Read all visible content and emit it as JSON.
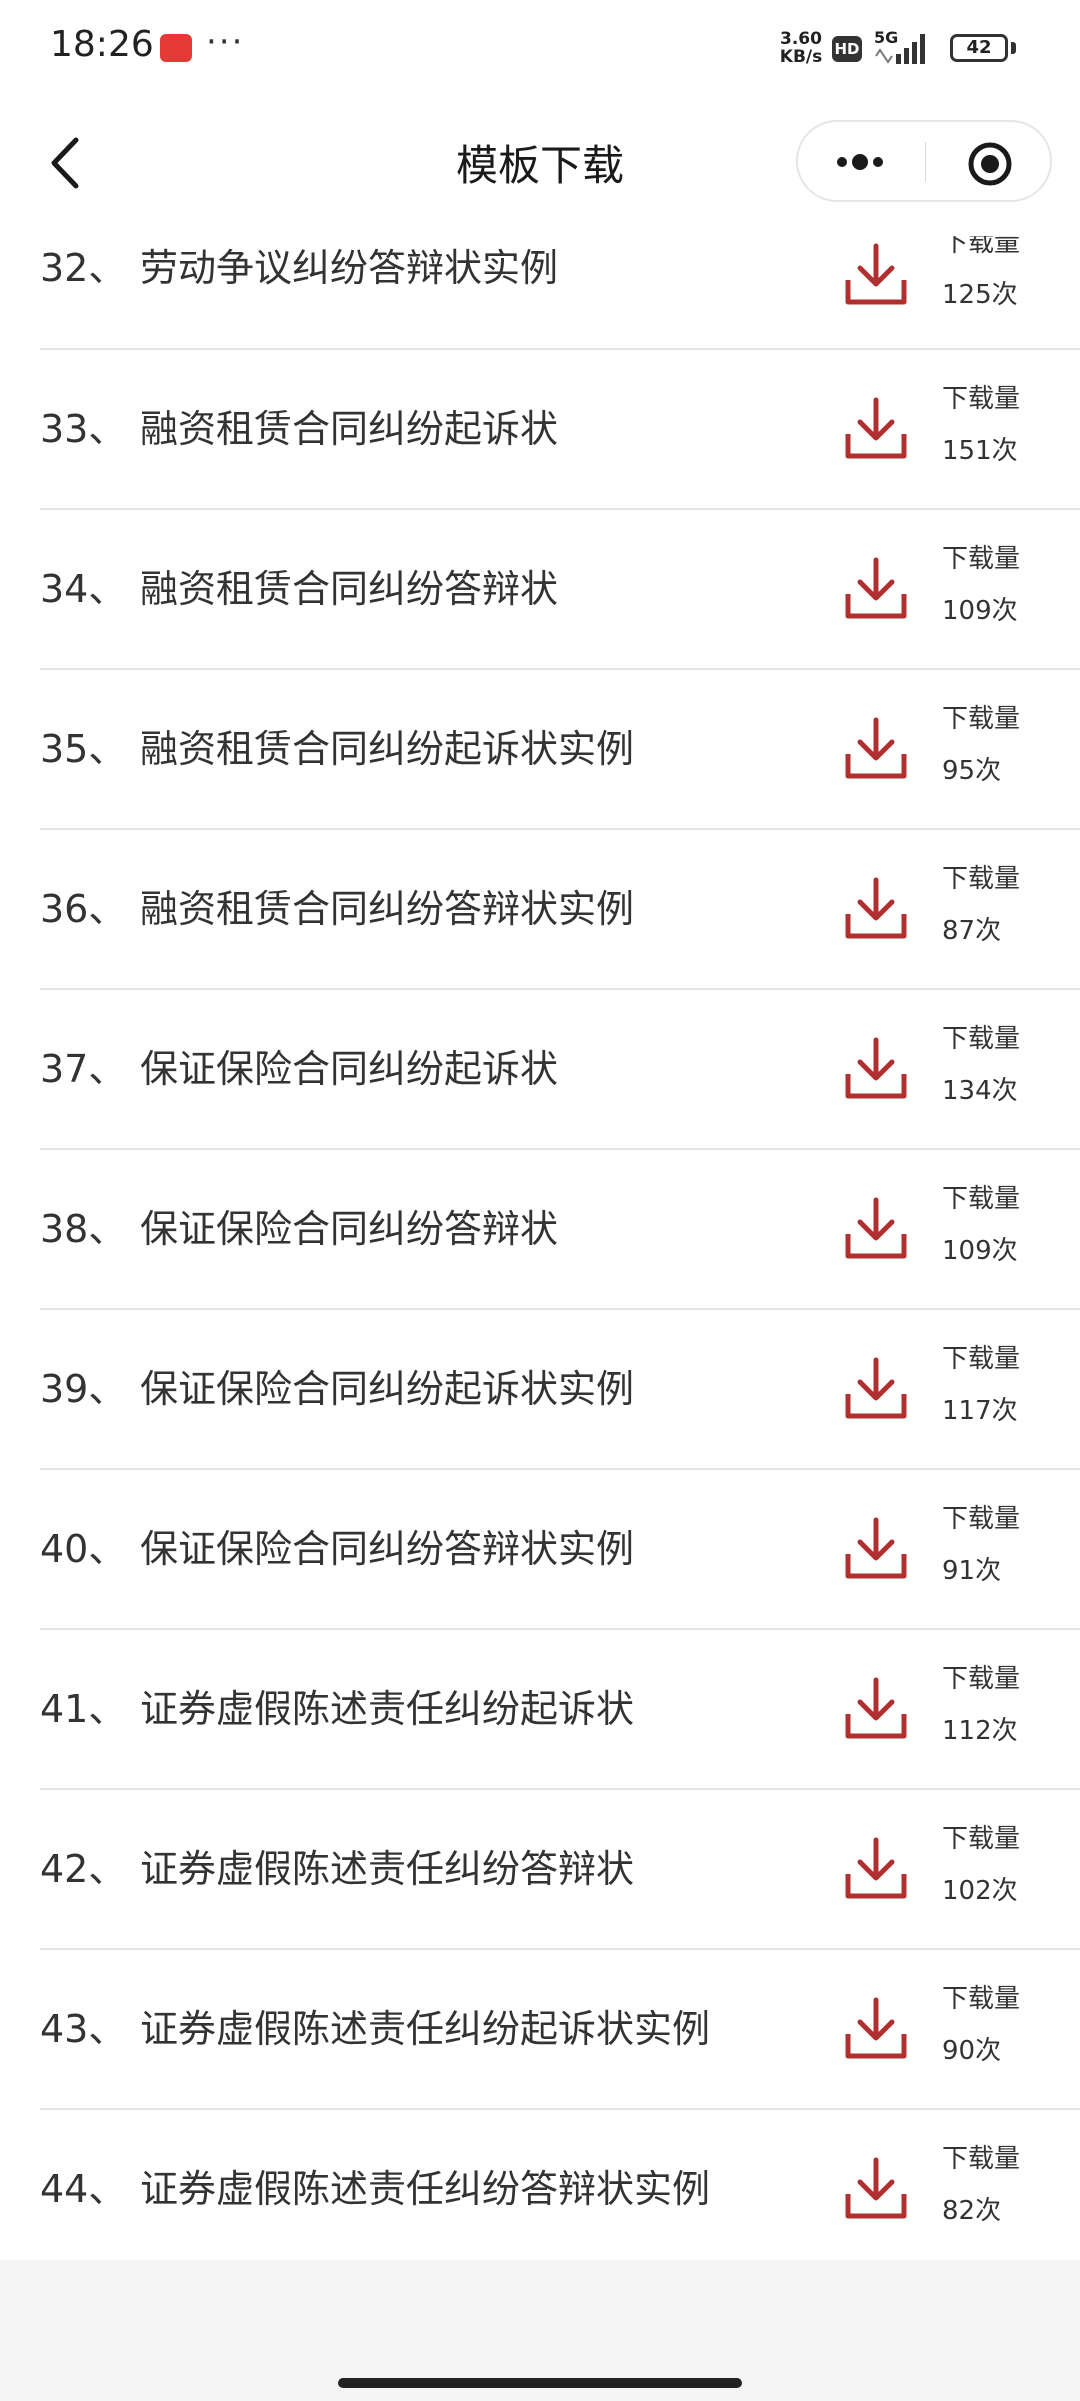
{
  "status_bar": {
    "time": "18:26",
    "more": "···",
    "net_speed_value": "3.60",
    "net_speed_unit": "KB/s",
    "hd": "HD",
    "network": "5G",
    "battery": "42"
  },
  "nav": {
    "title": "模板下载",
    "icons": [
      "back-icon",
      "more-dots-icon",
      "target-icon"
    ]
  },
  "list": {
    "download_label": "下载量",
    "accent_color": "#b03030",
    "items": [
      {
        "num": "32、",
        "title": "劳动争议纠纷答辩状实例",
        "count": "125次"
      },
      {
        "num": "33、",
        "title": "融资租赁合同纠纷起诉状",
        "count": "151次"
      },
      {
        "num": "34、",
        "title": "融资租赁合同纠纷答辩状",
        "count": "109次"
      },
      {
        "num": "35、",
        "title": "融资租赁合同纠纷起诉状实例",
        "count": "95次"
      },
      {
        "num": "36、",
        "title": "融资租赁合同纠纷答辩状实例",
        "count": "87次"
      },
      {
        "num": "37、",
        "title": "保证保险合同纠纷起诉状",
        "count": "134次"
      },
      {
        "num": "38、",
        "title": "保证保险合同纠纷答辩状",
        "count": "109次"
      },
      {
        "num": "39、",
        "title": "保证保险合同纠纷起诉状实例",
        "count": "117次"
      },
      {
        "num": "40、",
        "title": "保证保险合同纠纷答辩状实例",
        "count": "91次"
      },
      {
        "num": "41、",
        "title": "证券虚假陈述责任纠纷起诉状",
        "count": "112次"
      },
      {
        "num": "42、",
        "title": "证券虚假陈述责任纠纷答辩状",
        "count": "102次"
      },
      {
        "num": "43、",
        "title": "证券虚假陈述责任纠纷起诉状实例",
        "count": "90次"
      },
      {
        "num": "44、",
        "title": "证券虚假陈述责任纠纷答辩状实例",
        "count": "82次"
      }
    ]
  }
}
